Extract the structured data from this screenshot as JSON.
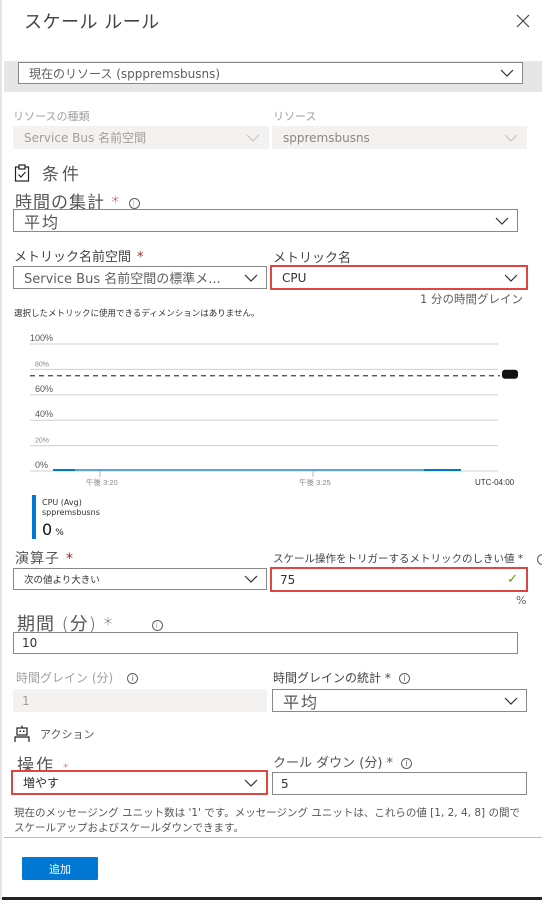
{
  "panel": {
    "title": "スケール ルール",
    "close_icon": "close-icon"
  },
  "scope": {
    "value": "現在のリソース (spppremsbusns)"
  },
  "resource_type": {
    "label": "リソースの種類",
    "value": "Service Bus 名前空間"
  },
  "resource": {
    "label": "リソース",
    "value": "sppremsbusns"
  },
  "condition": {
    "icon": "clipboard-check-icon",
    "heading": "条件",
    "time_aggregation": {
      "label": "時間の集計",
      "required": "*",
      "value": "平均"
    },
    "metric_namespace": {
      "label": "メトリック名前空間",
      "required": "*",
      "value": "Service  Bus 名前空間の標準メ..."
    },
    "metric_name": {
      "label": "メトリック名",
      "value": "CPU",
      "hint": "1 分の時間グレイン"
    },
    "dimension_note": "選択したメトリックに使用できるディメンションはありません。"
  },
  "chart_data": {
    "type": "line",
    "title": "",
    "xlabel": "",
    "ylabel": "",
    "y_ticks": [
      "100%",
      "80%",
      "60%",
      "40%",
      "20%",
      "0%"
    ],
    "y_tick_values": [
      100,
      80,
      60,
      40,
      20,
      0
    ],
    "ylim": [
      0,
      100
    ],
    "x_ticks": [
      "午後 3:20",
      "午後 3:25"
    ],
    "timezone_label": "UTC-04:00",
    "grid": true,
    "threshold": {
      "value": 75,
      "style": "dashed"
    },
    "series": [
      {
        "name": "CPU (Avg)",
        "resource": "sppremsbusns",
        "color": "#0078d4",
        "x": [
          "3:18",
          "3:19",
          "3:20",
          "3:21",
          "3:22",
          "3:23",
          "3:24",
          "3:25",
          "3:26",
          "3:27",
          "3:28"
        ],
        "values": [
          0,
          0,
          0,
          0,
          0,
          0,
          0,
          0,
          0,
          0,
          0
        ]
      }
    ],
    "legend": {
      "series_label": "CPU (Avg)",
      "resource_label": "sppremsbusns",
      "value": "0",
      "unit": "%",
      "placement": "bottom-left"
    }
  },
  "operator": {
    "label": "演算子",
    "required": "*",
    "value": "次の値より大きい"
  },
  "threshold": {
    "label": "スケール操作をトリガーするメトリックのしきい値 *",
    "value": "75",
    "unit": "%"
  },
  "duration": {
    "label": "期間 (分) *",
    "value": "10"
  },
  "time_grain": {
    "label": "時間グレイン (分)",
    "value": "1"
  },
  "time_grain_stat": {
    "label": "時間グレインの統計 *",
    "value": "平均"
  },
  "action": {
    "icon": "robot-icon",
    "heading": "アクション",
    "operation": {
      "label": "操作",
      "required": "*",
      "value": "増やす"
    },
    "cooldown": {
      "label": "クール ダウン (分) *",
      "value": "5"
    },
    "note_line1": "現在のメッセージング ユニット数は '1' です。メッセージング ユニットは、これらの値 [1, 2, 4, 8] の間で",
    "note_line2": "スケールアップおよびスケールダウンできます。"
  },
  "footer": {
    "add_label": "追加"
  },
  "colors": {
    "accent": "#0078d4",
    "highlight_border": "#e0453f",
    "required": "#a4262c",
    "valid_check": "#57a300"
  }
}
